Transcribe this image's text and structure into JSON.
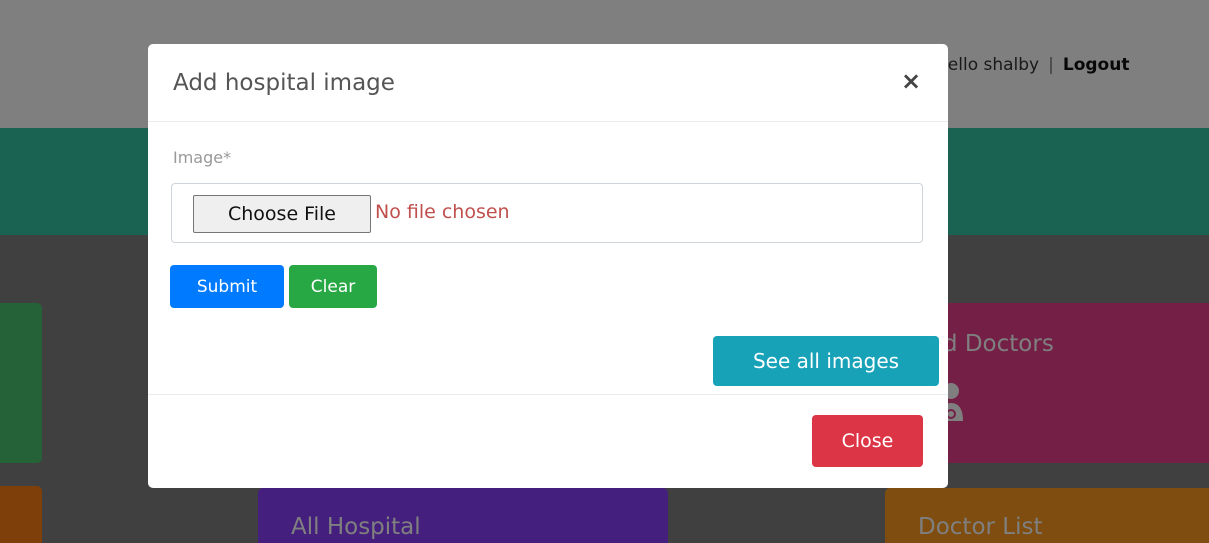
{
  "background": {
    "greeting": "Hello shalby",
    "separator": "|",
    "logout_label": "Logout",
    "cards": {
      "add_doctors": "Add Doctors",
      "all_hospital": "All Hospital",
      "doctor_list": "Doctor List"
    },
    "doctor_icon": "doctor-icon"
  },
  "modal": {
    "title": "Add hospital image",
    "close_icon": "close-icon",
    "close_glyph": "×",
    "image_label": "Image*",
    "choose_file_label": "Choose File",
    "no_file_text": "No file chosen",
    "submit_label": "Submit",
    "clear_label": "Clear",
    "see_all_label": "See all images",
    "close_label": "Close"
  },
  "colors": {
    "primary": "#007bff",
    "success": "#28a745",
    "info": "#17a2b8",
    "danger": "#dc3545",
    "hero": "#35c5a5"
  }
}
